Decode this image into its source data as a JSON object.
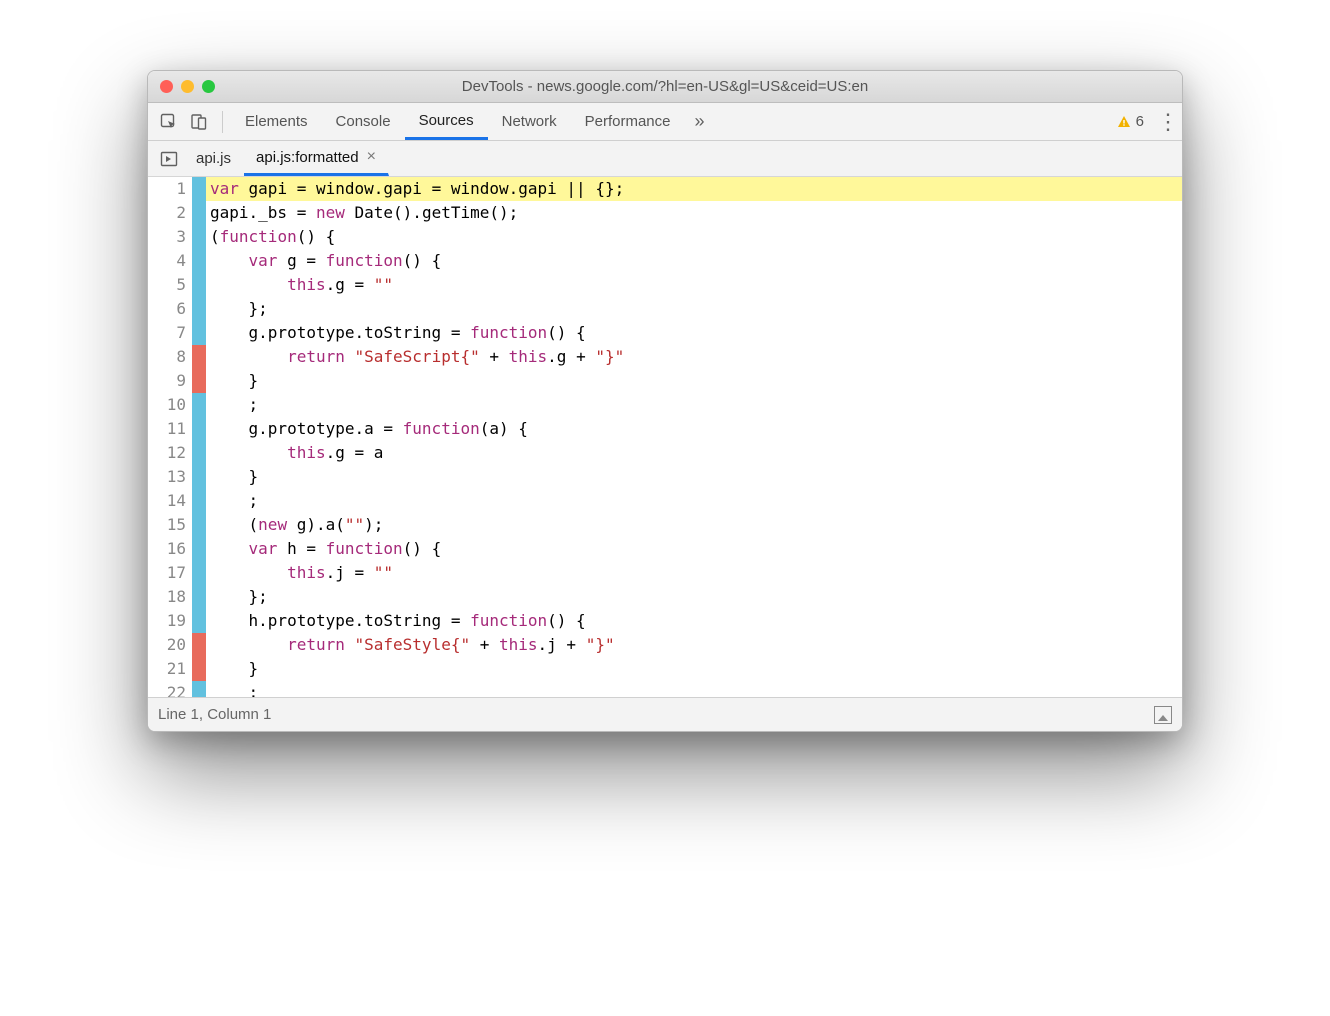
{
  "window": {
    "title": "DevTools - news.google.com/?hl=en-US&gl=US&ceid=US:en"
  },
  "tabs": {
    "items": [
      "Elements",
      "Console",
      "Sources",
      "Network",
      "Performance"
    ],
    "active": "Sources",
    "overflow_glyph": "»",
    "warnings": {
      "count": "6"
    }
  },
  "filetabs": {
    "items": [
      {
        "label": "api.js",
        "active": false,
        "closable": false
      },
      {
        "label": "api.js:formatted",
        "active": true,
        "closable": true
      }
    ]
  },
  "code": {
    "lines": [
      {
        "n": 1,
        "cov": "b",
        "hl": true,
        "html": "<span class='kw'>var</span> gapi = window.gapi = window.gapi || {};"
      },
      {
        "n": 2,
        "cov": "b",
        "hl": false,
        "html": "gapi._bs = <span class='kw'>new</span> Date().getTime();"
      },
      {
        "n": 3,
        "cov": "b",
        "hl": false,
        "html": "(<span class='kw'>function</span>() {"
      },
      {
        "n": 4,
        "cov": "b",
        "hl": false,
        "html": "    <span class='kw'>var</span> g = <span class='kw'>function</span>() {"
      },
      {
        "n": 5,
        "cov": "b",
        "hl": false,
        "html": "        <span class='kw'>this</span>.g = <span class='str'>\"\"</span>"
      },
      {
        "n": 6,
        "cov": "b",
        "hl": false,
        "html": "    };"
      },
      {
        "n": 7,
        "cov": "b",
        "hl": false,
        "html": "    g.prototype.toString = <span class='kw'>function</span>() {"
      },
      {
        "n": 8,
        "cov": "r",
        "hl": false,
        "html": "        <span class='kw'>return</span> <span class='str'>\"SafeScript{\"</span> + <span class='kw'>this</span>.g + <span class='str'>\"}\"</span>"
      },
      {
        "n": 9,
        "cov": "r",
        "hl": false,
        "html": "    }"
      },
      {
        "n": 10,
        "cov": "b",
        "hl": false,
        "html": "    ;"
      },
      {
        "n": 11,
        "cov": "b",
        "hl": false,
        "html": "    g.prototype.a = <span class='kw'>function</span>(a) {"
      },
      {
        "n": 12,
        "cov": "b",
        "hl": false,
        "html": "        <span class='kw'>this</span>.g = a"
      },
      {
        "n": 13,
        "cov": "b",
        "hl": false,
        "html": "    }"
      },
      {
        "n": 14,
        "cov": "b",
        "hl": false,
        "html": "    ;"
      },
      {
        "n": 15,
        "cov": "b",
        "hl": false,
        "html": "    (<span class='kw'>new</span> g).a(<span class='str'>\"\"</span>);"
      },
      {
        "n": 16,
        "cov": "b",
        "hl": false,
        "html": "    <span class='kw'>var</span> h = <span class='kw'>function</span>() {"
      },
      {
        "n": 17,
        "cov": "b",
        "hl": false,
        "html": "        <span class='kw'>this</span>.j = <span class='str'>\"\"</span>"
      },
      {
        "n": 18,
        "cov": "b",
        "hl": false,
        "html": "    };"
      },
      {
        "n": 19,
        "cov": "b",
        "hl": false,
        "html": "    h.prototype.toString = <span class='kw'>function</span>() {"
      },
      {
        "n": 20,
        "cov": "r",
        "hl": false,
        "html": "        <span class='kw'>return</span> <span class='str'>\"SafeStyle{\"</span> + <span class='kw'>this</span>.j + <span class='str'>\"}\"</span>"
      },
      {
        "n": 21,
        "cov": "r",
        "hl": false,
        "html": "    }"
      },
      {
        "n": 22,
        "cov": "b",
        "hl": false,
        "html": "    ;"
      }
    ]
  },
  "status": {
    "text": "Line 1, Column 1"
  }
}
